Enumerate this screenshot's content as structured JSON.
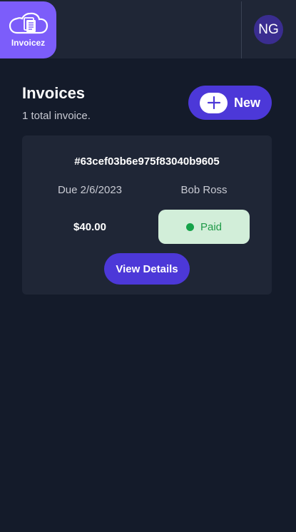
{
  "app": {
    "logo_label": "Invoicez",
    "avatar_initials": "NG"
  },
  "header": {
    "title": "Invoices",
    "subtitle": "1 total invoice.",
    "new_button_label": "New"
  },
  "invoices": [
    {
      "id": "#63cef03b6e975f83040b9605",
      "due": "Due 2/6/2023",
      "client": "Bob Ross",
      "amount": "$40.00",
      "status": "Paid",
      "action_label": "View Details"
    }
  ],
  "colors": {
    "background": "#141b2a",
    "surface": "#1f2636",
    "brand": "#7c5dfa",
    "primary_button": "#4c38d8",
    "avatar": "#3a2d90",
    "paid_bg": "#d2eed9",
    "paid_dot": "#16a34a",
    "paid_text": "#1f9a47"
  },
  "icons": {
    "logo": "cloud-document-icon",
    "new": "plus-icon",
    "status": "status-dot-icon"
  }
}
